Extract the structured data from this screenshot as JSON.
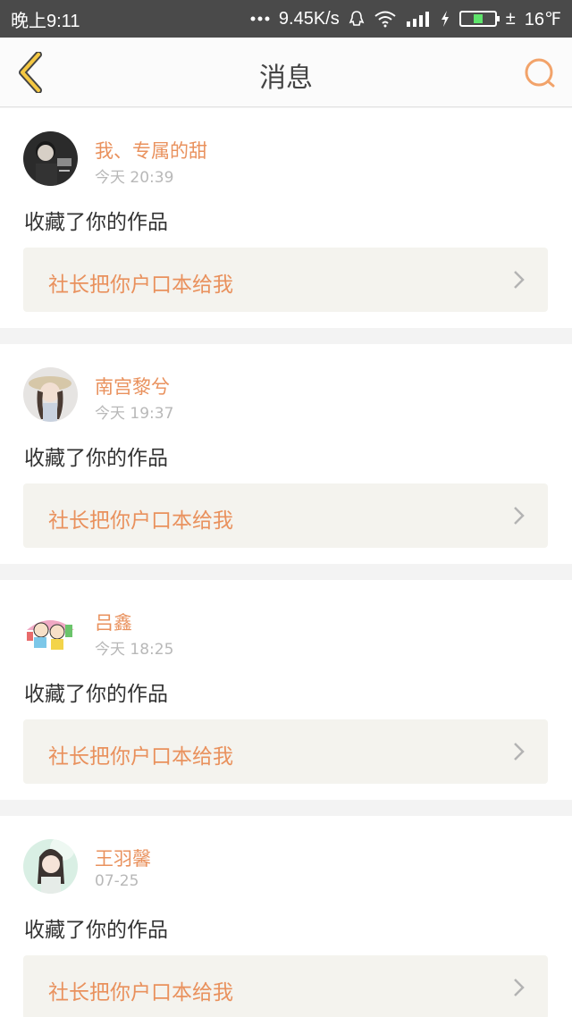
{
  "status_bar": {
    "time": "晚上9:11",
    "network_speed": "9.45K/s",
    "charge_symbol": "±",
    "temperature": "16℉",
    "battery_level": 0.3,
    "icons": [
      "more-dots-icon",
      "qq-icon",
      "wifi-icon",
      "signal-icon",
      "charging-icon",
      "battery-icon"
    ]
  },
  "navbar": {
    "title": "消息",
    "back_icon": "back-chevron-icon",
    "search_icon": "search-icon",
    "accent_color": "#f2a36a"
  },
  "messages": [
    {
      "username": "我、专属的甜",
      "time": "今天 20:39",
      "action": "收藏了你的作品",
      "work_title": "社长把你户口本给我",
      "avatar": "avatar-dark-photo"
    },
    {
      "username": "南宫黎兮",
      "time": "今天 19:37",
      "action": "收藏了你的作品",
      "work_title": "社长把你户口本给我",
      "avatar": "avatar-girl-hat"
    },
    {
      "username": "吕鑫",
      "time": "今天 18:25",
      "action": "收藏了你的作品",
      "work_title": "社长把你户口本给我",
      "avatar": "avatar-cartoon-kids"
    },
    {
      "username": "王羽馨",
      "time": "07-25",
      "action": "收藏了你的作品",
      "work_title": "社长把你户口本给我",
      "avatar": "avatar-girl-green"
    }
  ],
  "colors": {
    "username": "#e9915d",
    "work_title": "#e9915d",
    "timestamp": "#b8b8b8",
    "status_bar_bg": "#4a4a4a",
    "link_bg": "#f4f3ee"
  }
}
